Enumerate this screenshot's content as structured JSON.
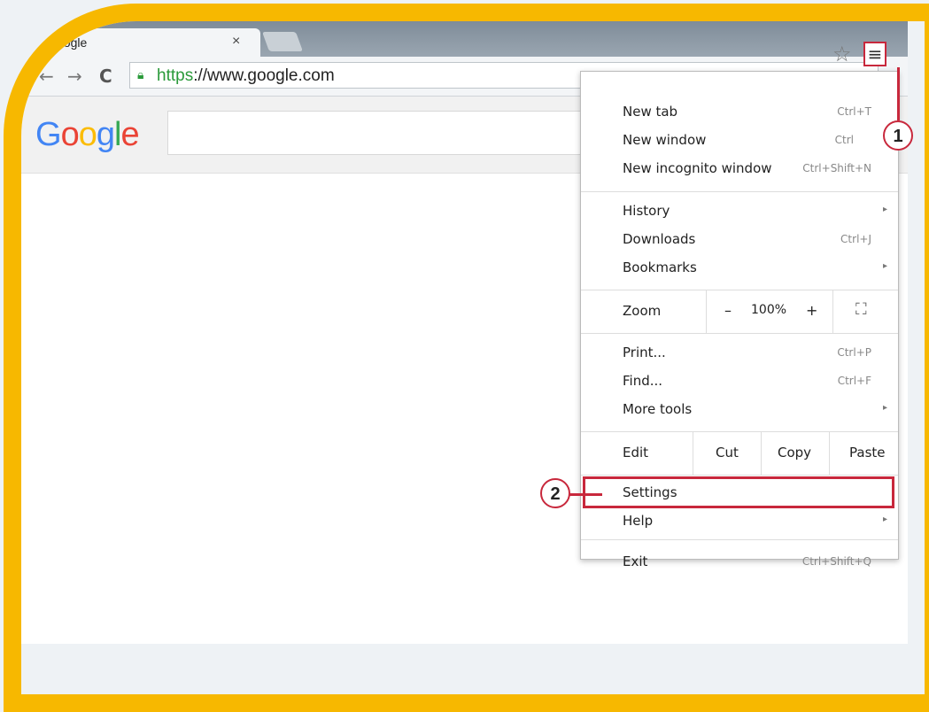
{
  "tab": {
    "title": "oogle",
    "close": "×"
  },
  "toolbar": {
    "back": "←",
    "forward": "→",
    "reload": "C",
    "url_scheme": "https",
    "url_rest": "://www.google.com",
    "star": "☆",
    "menu": "≡"
  },
  "page": {
    "logo": [
      "G",
      "o",
      "o",
      "g",
      "l",
      "e"
    ],
    "logo_colors": [
      "#4285f4",
      "#ea4335",
      "#fbbc05",
      "#4285f4",
      "#34a853",
      "#ea4335"
    ]
  },
  "menu": {
    "new_tab": {
      "label": "New tab",
      "shortcut": "Ctrl+T"
    },
    "new_window": {
      "label": "New window",
      "shortcut": "Ctrl"
    },
    "new_incognito": {
      "label": "New incognito window",
      "shortcut": "Ctrl+Shift+N"
    },
    "history": {
      "label": "History",
      "arrow": "▸"
    },
    "downloads": {
      "label": "Downloads",
      "shortcut": "Ctrl+J"
    },
    "bookmarks": {
      "label": "Bookmarks",
      "arrow": "▸"
    },
    "zoom": {
      "label": "Zoom",
      "minus": "–",
      "value": "100%",
      "plus": "+",
      "fullscreen": "⛶"
    },
    "print": {
      "label": "Print...",
      "shortcut": "Ctrl+P"
    },
    "find": {
      "label": "Find...",
      "shortcut": "Ctrl+F"
    },
    "more_tools": {
      "label": "More tools",
      "arrow": "▸"
    },
    "edit": {
      "label": "Edit",
      "cut": "Cut",
      "copy": "Copy",
      "paste": "Paste"
    },
    "settings": {
      "label": "Settings"
    },
    "help": {
      "label": "Help",
      "arrow": "▸"
    },
    "exit": {
      "label": "Exit",
      "shortcut": "Ctrl+Shift+Q"
    }
  },
  "callouts": {
    "one": "1",
    "two": "2"
  },
  "colors": {
    "accent": "#c8283c",
    "frame": "#f7b800"
  }
}
